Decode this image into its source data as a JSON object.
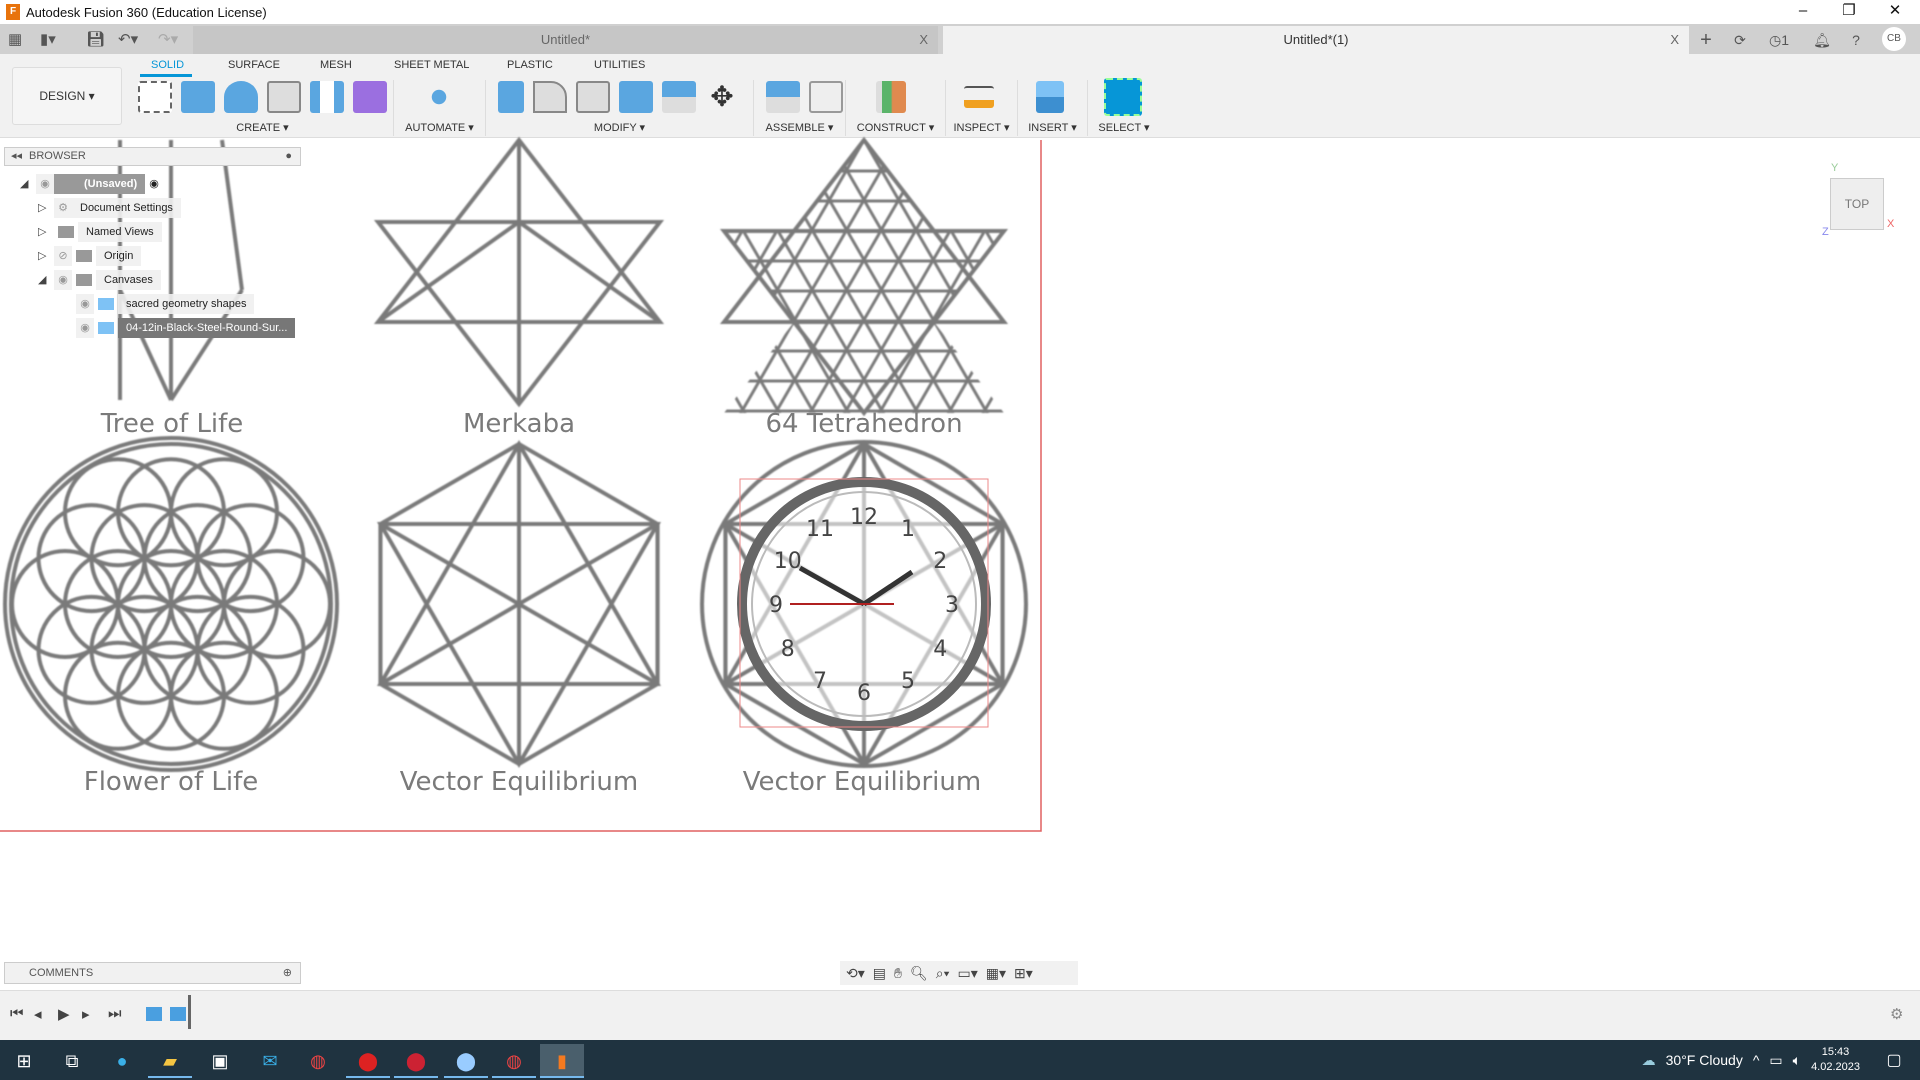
{
  "app": {
    "title": "Autodesk Fusion 360 (Education License)",
    "min": "–",
    "restore": "❐",
    "close": "✕"
  },
  "tabs": [
    {
      "label": "Untitled*"
    },
    {
      "label": "Untitled*(1)"
    }
  ],
  "tab_close": "X",
  "header_icons": {
    "add": "+",
    "notification_count": "1",
    "user": "CB"
  },
  "toolbar": {
    "workspace": "DESIGN ▾",
    "tabs": [
      "SOLID",
      "SURFACE",
      "MESH",
      "SHEET METAL",
      "PLASTIC",
      "UTILITIES"
    ],
    "groups": [
      "CREATE ▾",
      "AUTOMATE ▾",
      "MODIFY ▾",
      "ASSEMBLE ▾",
      "CONSTRUCT ▾",
      "INSPECT ▾",
      "INSERT ▾",
      "SELECT ▾"
    ]
  },
  "browser": {
    "title": "BROWSER",
    "nodes": [
      "(Unsaved)",
      "Document Settings",
      "Named Views",
      "Origin",
      "Canvases",
      "sacred geometry shapes",
      "04-12in-Black-Steel-Round-Sur..."
    ]
  },
  "canvas": {
    "labels": [
      "Tree of Life",
      "Merkaba",
      "64 Tetrahedron",
      "Flower of Life",
      "Vector Equilibrium",
      "Vector Equilibrium"
    ],
    "clock_numbers": [
      "12",
      "1",
      "2",
      "3",
      "4",
      "5",
      "6",
      "7",
      "8",
      "9",
      "10",
      "11"
    ]
  },
  "viewcube": {
    "face": "TOP",
    "x": "X",
    "y": "Y",
    "z": "Z"
  },
  "comments": {
    "title": "COMMENTS"
  },
  "taskbar": {
    "weather": "30°F  Cloudy",
    "time": "15:43",
    "date": "4.02.2023"
  },
  "colors": {
    "accent": "#0696d7",
    "taskbar": "#1f3340",
    "canvas_border": "#e06060"
  }
}
